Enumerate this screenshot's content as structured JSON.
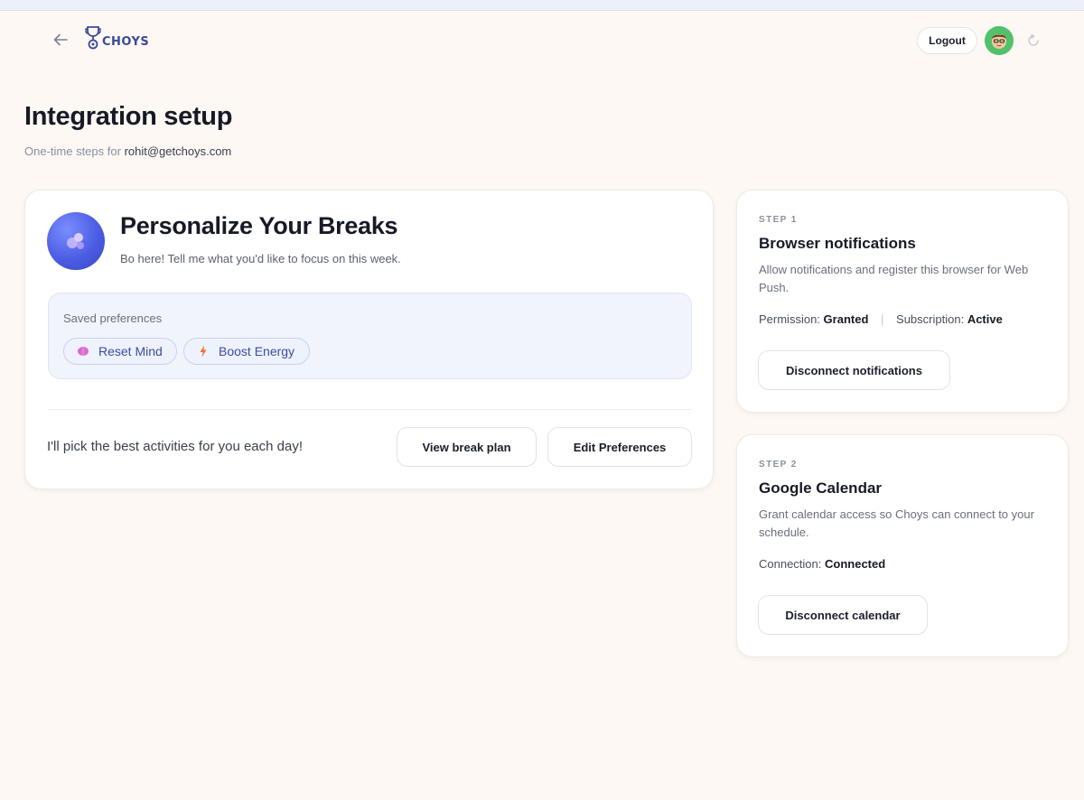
{
  "header": {
    "logo_text": "CHOYS",
    "logout_label": "Logout"
  },
  "page": {
    "title": "Integration setup",
    "subtitle_prefix": "One-time steps for",
    "user_email": "rohit@getchoys.com"
  },
  "breaks_card": {
    "title": "Personalize Your Breaks",
    "subtitle": "Bo here! Tell me what you'd like to focus on this week.",
    "saved_label": "Saved preferences",
    "preferences": [
      {
        "label": "Reset Mind",
        "icon": "brain-icon",
        "color": "#d96bd0"
      },
      {
        "label": "Boost Energy",
        "icon": "lightning-icon",
        "color": "#f0733a"
      }
    ],
    "tagline": "I'll pick the best activities for you each day!",
    "view_plan_label": "View break plan",
    "edit_prefs_label": "Edit Preferences"
  },
  "steps": [
    {
      "step_label": "STEP 1",
      "title": "Browser notifications",
      "description": "Allow notifications and register this browser for Web Push.",
      "permission_label": "Permission:",
      "permission_value": "Granted",
      "subscription_label": "Subscription:",
      "subscription_value": "Active",
      "button_label": "Disconnect notifications"
    },
    {
      "step_label": "STEP 2",
      "title": "Google Calendar",
      "description": "Grant calendar access so Choys can connect to your schedule.",
      "connection_label": "Connection:",
      "connection_value": "Connected",
      "button_label": "Disconnect calendar"
    }
  ],
  "colors": {
    "background": "#fdf8f3",
    "accent": "#3b4a9a",
    "chip_background": "#eef2fc"
  }
}
